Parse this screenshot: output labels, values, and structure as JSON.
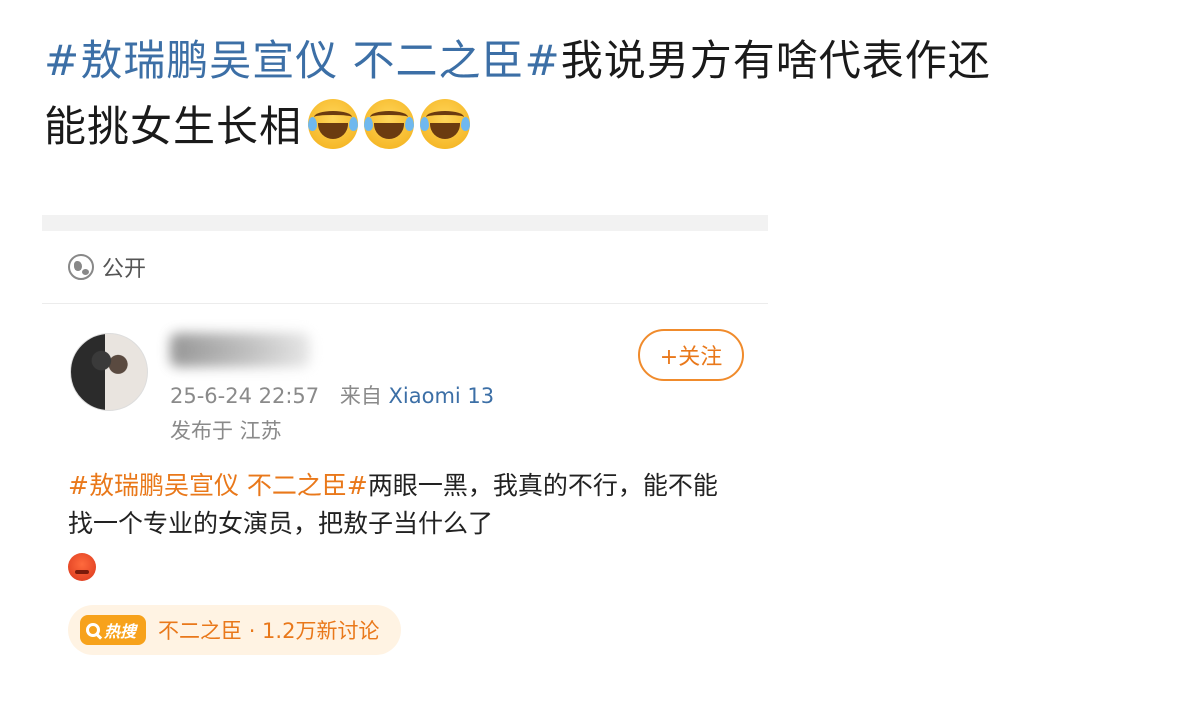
{
  "post": {
    "hashtag": "#敖瑞鹏吴宣仪 不二之臣#",
    "text_line1": "我说男方有啥代表作还",
    "text_line2": "能挑女生长相",
    "emojis": [
      "laugh-cry-emoji",
      "laugh-cry-emoji",
      "laugh-cry-emoji"
    ]
  },
  "screenshot": {
    "visibility_label": "公开",
    "author": {
      "timestamp": "25-6-24 22:57",
      "source_prefix": "来自",
      "device": "Xiaomi 13",
      "location": "发布于 江苏"
    },
    "follow_label": "+关注",
    "repost": {
      "hashtag": "#敖瑞鹏吴宣仪 不二之臣#",
      "text": "两眼一黑，我真的不行，能不能找一个专业的女演员，把敖子当什么了",
      "emoji": "angry-emoji"
    },
    "hot_search": {
      "badge": "热搜",
      "topic": "不二之臣 · 1.2万新讨论"
    }
  },
  "colors": {
    "hashtag_blue": "#3c6fa6",
    "accent_orange": "#e9781a",
    "hot_bg": "#fff3e3"
  }
}
